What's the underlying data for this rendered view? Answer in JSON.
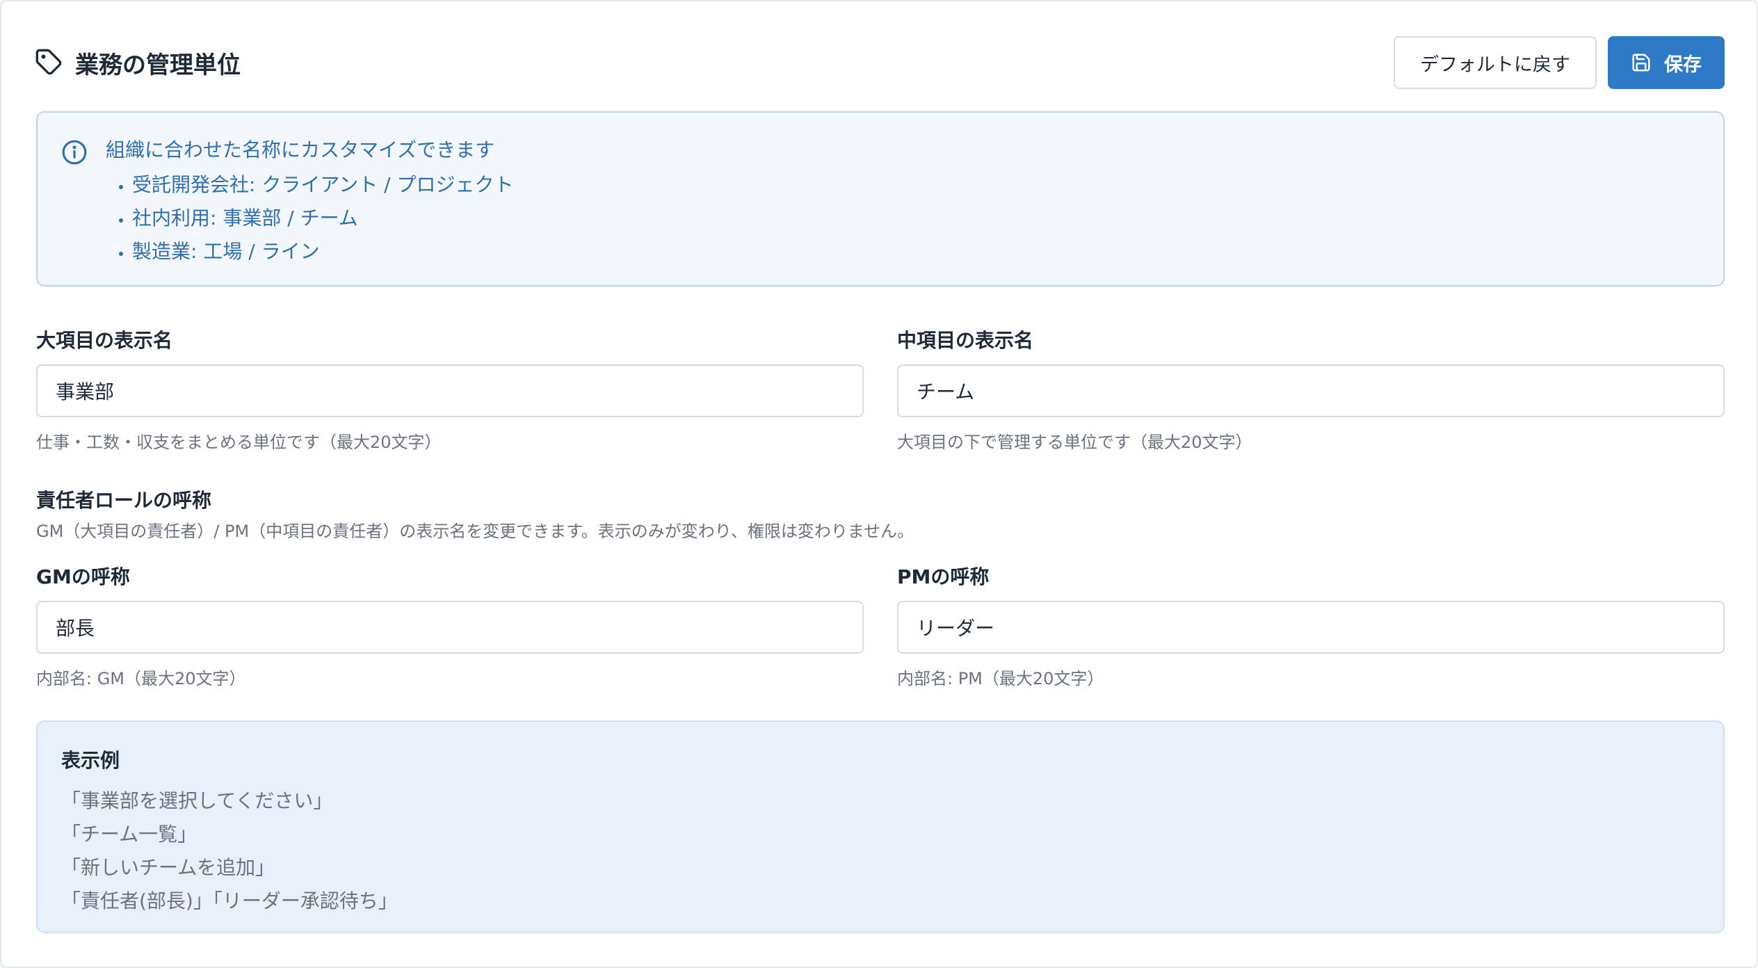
{
  "header": {
    "title": "業務の管理単位",
    "title_icon": "tag-icon",
    "default_button": "デフォルトに戻す",
    "save_button": "保存",
    "save_icon": "save-icon"
  },
  "info": {
    "icon": "info-icon",
    "title": "組織に合わせた名称にカスタマイズできます",
    "items": [
      "受託開発会社: クライアント / プロジェクト",
      "社内利用: 事業部 / チーム",
      "製造業: 工場 / ライン"
    ]
  },
  "fields": {
    "major": {
      "label": "大項目の表示名",
      "value": "事業部",
      "hint": "仕事・工数・収支をまとめる単位です（最大20文字）"
    },
    "middle": {
      "label": "中項目の表示名",
      "value": "チーム",
      "hint": "大項目の下で管理する単位です（最大20文字）"
    }
  },
  "roles": {
    "title": "責任者ロールの呼称",
    "description": "GM（大項目の責任者）/ PM（中項目の責任者）の表示名を変更できます。表示のみが変わり、権限は変わりません。",
    "gm": {
      "label": "GMの呼称",
      "value": "部長",
      "hint": "内部名: GM（最大20文字）"
    },
    "pm": {
      "label": "PMの呼称",
      "value": "リーダー",
      "hint": "内部名: PM（最大20文字）"
    }
  },
  "example": {
    "title": "表示例",
    "lines": [
      "「事業部を選択してください」",
      "「チーム一覧」",
      "「新しいチームを追加」",
      "「責任者(部長)」「リーダー承認待ち」"
    ]
  },
  "colors": {
    "primary": "#2f7ac6",
    "info_text": "#2f6fb0",
    "info_bg": "#f3f7fb",
    "example_bg": "#e8f1fa"
  }
}
